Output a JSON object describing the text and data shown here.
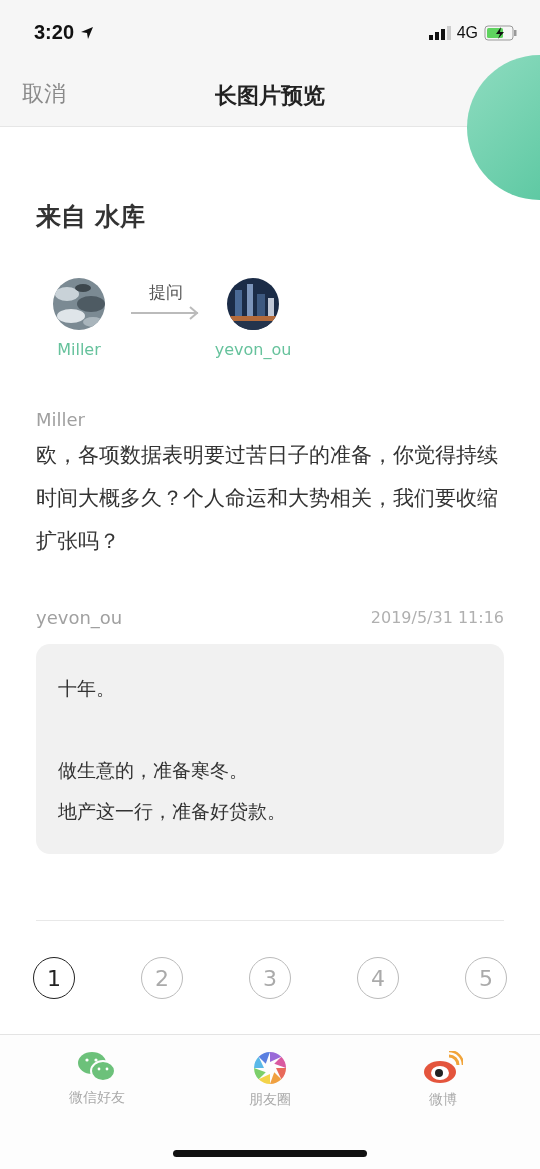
{
  "status_bar": {
    "time": "3:20",
    "network": "4G"
  },
  "nav": {
    "cancel": "取消",
    "title": "长图片预览"
  },
  "source": {
    "title": "来自 水库"
  },
  "exchange": {
    "asker": "Miller",
    "action": "提问",
    "answerer": "yevon_ou"
  },
  "question": {
    "author": "Miller",
    "text": "欧，各项数据表明要过苦日子的准备，你觉得持续时间大概多久？个人命运和大势相关，我们要收缩扩张吗？"
  },
  "answer": {
    "author": "yevon_ou",
    "date": "2019/5/31 11:16",
    "paragraphs": [
      [
        "十年。"
      ],
      [
        "做生意的，准备寒冬。",
        "地产这一行，准备好贷款。"
      ]
    ]
  },
  "pages": [
    {
      "label": "1",
      "selected": true
    },
    {
      "label": "2",
      "selected": false
    },
    {
      "label": "3",
      "selected": false
    },
    {
      "label": "4",
      "selected": false
    },
    {
      "label": "5",
      "selected": false
    }
  ],
  "share": [
    {
      "kind": "wechat",
      "label": "微信好友"
    },
    {
      "kind": "moments",
      "label": "朋友圈"
    },
    {
      "kind": "weibo",
      "label": "微博"
    }
  ]
}
